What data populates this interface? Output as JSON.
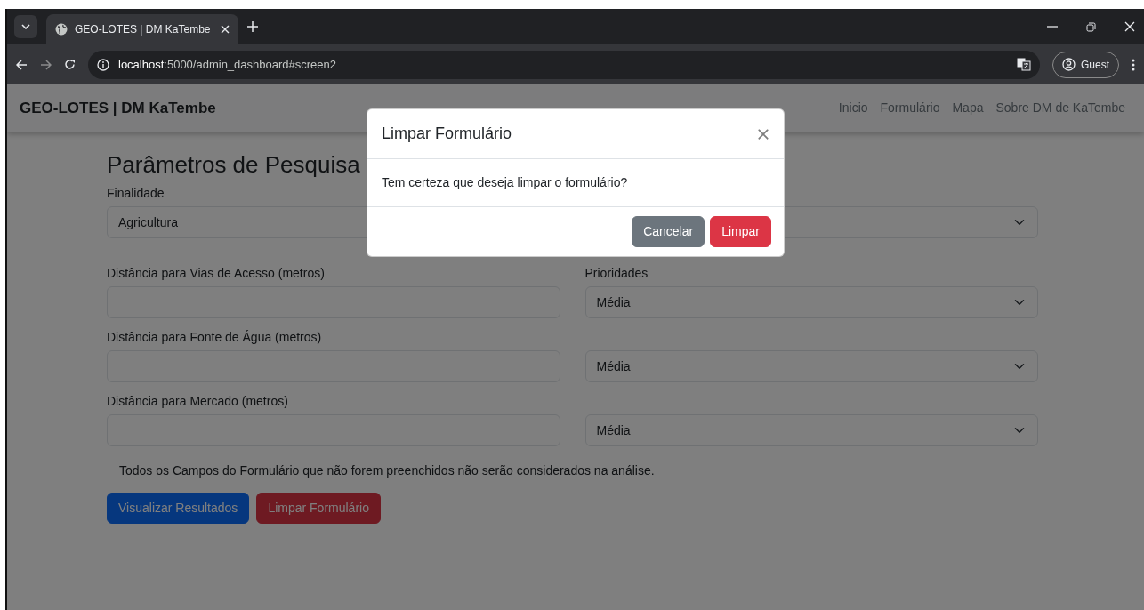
{
  "browser": {
    "tab_title": "GEO-LOTES | DM KaTembe",
    "url_host": "localhost",
    "url_rest": ":5000/admin_dashboard#screen2",
    "profile": "Guest"
  },
  "navbar": {
    "brand": "GEO-LOTES | DM KaTembe",
    "links": [
      "Inicio",
      "Formulário",
      "Mapa",
      "Sobre DM de KaTembe"
    ]
  },
  "form": {
    "title": "Parâmetros de Pesquisa",
    "rows": [
      {
        "left": {
          "label": "Finalidade",
          "kind": "select",
          "value": "Agricultura"
        },
        "right": {
          "kind": "select"
        }
      },
      {
        "left": {
          "label": "Distância para Vias de Acesso (metros)",
          "kind": "input"
        },
        "right": {
          "label": "Prioridades",
          "kind": "select",
          "value": "Média"
        }
      },
      {
        "left": {
          "label": "Distância para Fonte de Água (metros)",
          "kind": "input"
        },
        "right": {
          "kind": "select",
          "value": "Média"
        }
      },
      {
        "left": {
          "label": "Distância para Mercado (metros)",
          "kind": "input"
        },
        "right": {
          "kind": "select",
          "value": "Média"
        }
      }
    ],
    "note": "Todos os Campos do Formulário que não forem preenchidos não serão considerados na análise.",
    "buttons": [
      {
        "label": "Visualizar Resultados",
        "kind": "primary"
      },
      {
        "label": "Limpar Formulário",
        "kind": "danger"
      }
    ]
  },
  "modal": {
    "title": "Limpar Formulário",
    "body": "Tem certeza que deseja limpar o formulário?",
    "buttons": [
      {
        "label": "Cancelar",
        "kind": "secondary"
      },
      {
        "label": "Limpar",
        "kind": "danger"
      }
    ]
  }
}
